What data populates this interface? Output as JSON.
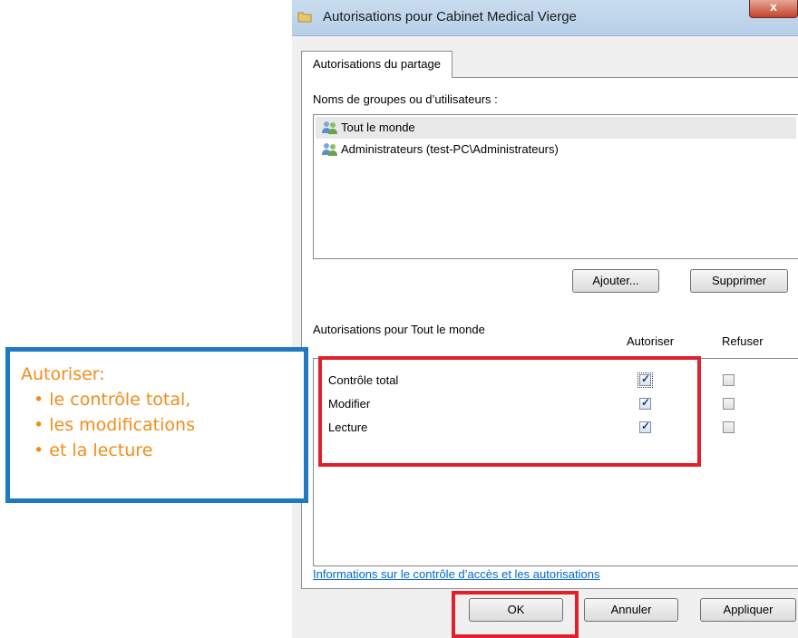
{
  "window": {
    "title": "Autorisations pour Cabinet Medical Vierge",
    "close_label": "x"
  },
  "tab": {
    "label": "Autorisations du partage"
  },
  "groups": {
    "label": "Noms de groupes ou d’utilisateurs :",
    "items": [
      {
        "label": "Tout le monde",
        "selected": true
      },
      {
        "label": "Administrateurs (test-PC\\Administrateurs)",
        "selected": false
      }
    ],
    "add_button": "Ajouter...",
    "remove_button": "Supprimer"
  },
  "permissions": {
    "label": "Autorisations pour Tout le monde",
    "allow_header": "Autoriser",
    "deny_header": "Refuser",
    "rows": [
      {
        "name": "Contrôle total",
        "allow": true,
        "deny": false
      },
      {
        "name": "Modifier",
        "allow": true,
        "deny": false
      },
      {
        "name": "Lecture",
        "allow": true,
        "deny": false
      }
    ]
  },
  "link": {
    "label": "Informations sur le contrôle d’accès et les autorisations"
  },
  "footer": {
    "ok": "OK",
    "cancel": "Annuler",
    "apply": "Appliquer"
  },
  "annotation": {
    "heading": "Autoriser:",
    "items": [
      "le contrôle total,",
      "les modifications",
      "et la lecture"
    ],
    "text_color": "#f28c1a",
    "border_color": "#1f78c1",
    "highlight_color": "#e0202a"
  }
}
